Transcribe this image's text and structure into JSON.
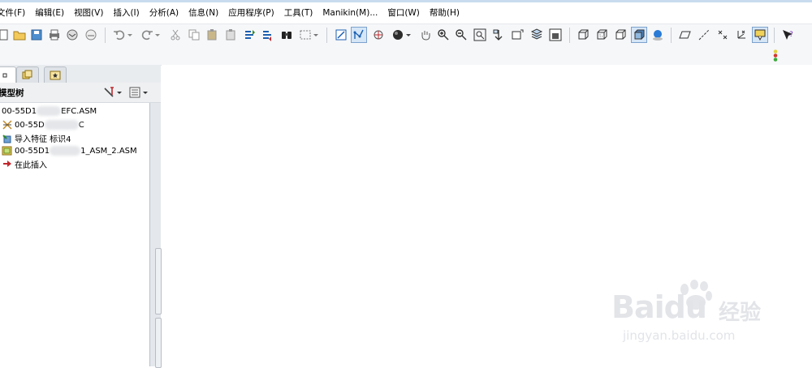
{
  "menu": {
    "items": [
      "文件(F)",
      "编辑(E)",
      "视图(V)",
      "插入(I)",
      "分析(A)",
      "信息(N)",
      "应用程序(P)",
      "工具(T)",
      "Manikin(M)...",
      "窗口(W)",
      "帮助(H)"
    ]
  },
  "navigator": {
    "tree_title": "模型树",
    "nodes": [
      {
        "prefix": "00-55D1",
        "suffix": "EFC.ASM",
        "icon": "assembly-root-icon"
      },
      {
        "prefix": "00-55D",
        "suffix": "C",
        "icon": "datum-csys-icon"
      },
      {
        "label": "导入特征 标识4",
        "icon": "import-feature-icon"
      },
      {
        "prefix": "00-55D1",
        "suffix": "1_ASM_2.ASM",
        "icon": "subassembly-icon"
      },
      {
        "label": "在此插入",
        "icon": "insert-here-arrow-icon"
      }
    ]
  },
  "watermark": {
    "brand": "Baidu",
    "cn": "经验",
    "url": "jingyan.baidu.com"
  },
  "colors": {
    "accent": "#7da2ce",
    "toolbar_bg": "#f6f7f9",
    "insert_arrow": "#c0282d"
  }
}
